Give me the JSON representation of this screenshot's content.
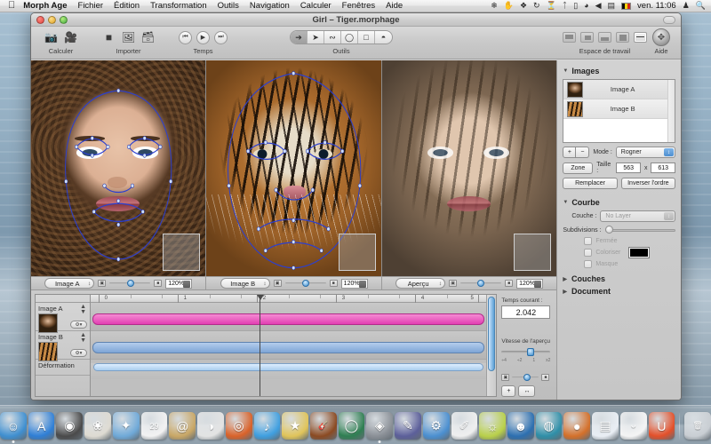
{
  "menubar": {
    "apple_icon": "apple-icon",
    "app_name": "Morph Age",
    "items": [
      "Fichier",
      "Édition",
      "Transformation",
      "Outils",
      "Navigation",
      "Calculer",
      "Fenêtres",
      "Aide"
    ],
    "status_icons": [
      "dropbox-icon",
      "hand-icon",
      "puzzle-icon",
      "sync-icon",
      "timemachine-icon",
      "bluetooth-icon",
      "display-icon",
      "wifi-icon",
      "volume-icon",
      "battery-icon"
    ],
    "flag": "belgium-flag-icon",
    "clock": "ven. 11:06",
    "user_icon": "user-icon",
    "search_icon": "search-icon"
  },
  "window": {
    "title": "Girl – Tiger.morphage",
    "toolbar": {
      "groups": [
        {
          "label": "Calculer",
          "icons": [
            "camera-icon",
            "film-icon"
          ]
        },
        {
          "label": "Importer",
          "icons": [
            "import-single-icon",
            "import-pair-icon",
            "import-stack-icon"
          ]
        },
        {
          "label": "Temps",
          "icons": [
            "rewind-icon",
            "play-icon",
            "forward-icon"
          ]
        },
        {
          "label": "Outils",
          "icons": [
            "arrow-tool-icon",
            "arrow-point-tool-icon",
            "curve-tool-icon",
            "ellipse-tool-icon",
            "rectangle-tool-icon",
            "mask-tool-icon"
          ]
        },
        {
          "label": "Espace de travail",
          "icons": [
            "layout-1-icon",
            "layout-2-icon",
            "layout-3-icon",
            "layout-4-icon",
            "layout-5-icon"
          ]
        },
        {
          "label": "Aide",
          "icons": [
            "help-icon"
          ]
        }
      ],
      "workspace_selected_index": 4,
      "tools_selected_index": 0
    }
  },
  "canvases": [
    {
      "name": "pane-image-a",
      "source_label": "Image A",
      "zoom": "120%",
      "subject": "woman-face"
    },
    {
      "name": "pane-image-b",
      "source_label": "Image B",
      "zoom": "120%",
      "subject": "tiger-face"
    },
    {
      "name": "pane-preview",
      "source_label": "Aperçu",
      "zoom": "120%",
      "subject": "morph-blend"
    }
  ],
  "timeline": {
    "tracks": [
      {
        "label": "Image A",
        "clip_color": "#e23fb3"
      },
      {
        "label": "Image B",
        "clip_color": "#7ea5d6"
      },
      {
        "label": "Déformation",
        "clip_color": "#7ea5d6"
      }
    ],
    "ruler_labels": [
      "0",
      "1",
      "2",
      "3",
      "4",
      "5"
    ],
    "playhead_time": 2.042,
    "current_time_label": "Temps courant :",
    "current_time_value": "2.042",
    "preview_speed_label": "Vitesse de l'aperçu",
    "preview_speed_ticks": [
      "÷4",
      "÷2",
      "1",
      "x2"
    ],
    "add_button": "+",
    "fit_button": "↔"
  },
  "inspector": {
    "images_section": {
      "title": "Images",
      "rows": [
        {
          "label": "Image A",
          "selected": true
        },
        {
          "label": "Image B",
          "selected": false
        }
      ],
      "add_label": "+",
      "remove_label": "−",
      "mode_label": "Mode :",
      "mode_value": "Rogner",
      "zone_button": "Zone",
      "size_label": "Taille :",
      "size_width": "563",
      "size_separator": "x",
      "size_height": "613",
      "replace_button": "Remplacer",
      "invert_button": "Inverser l'ordre"
    },
    "curve_section": {
      "title": "Courbe",
      "layer_label": "Couche :",
      "layer_value": "No Layer",
      "subdivisions_label": "Subdivisions :",
      "checkboxes": [
        {
          "label": "Fermée",
          "checked": false
        },
        {
          "label": "Coloriser",
          "checked": false
        },
        {
          "label": "Masque",
          "checked": false
        }
      ],
      "color_swatch": "#000000"
    },
    "collapsed_sections": [
      "Couches",
      "Document"
    ]
  },
  "dock": {
    "items": [
      {
        "name": "finder",
        "glyph": "☺",
        "color": "#3f8fd0",
        "running": true
      },
      {
        "name": "app-store",
        "glyph": "A",
        "color": "#2f7fd6",
        "running": false
      },
      {
        "name": "dvd-player",
        "glyph": "◉",
        "color": "#4a4a4a",
        "running": false
      },
      {
        "name": "iphoto",
        "glyph": "❀",
        "color": "#dedbd2",
        "running": false
      },
      {
        "name": "safari",
        "glyph": "✦",
        "color": "#6fa9d8",
        "running": false
      },
      {
        "name": "calendar",
        "glyph": "29",
        "color": "#f2f2f2",
        "running": false
      },
      {
        "name": "address-book",
        "glyph": "@",
        "color": "#c9a766",
        "running": false
      },
      {
        "name": "iweb",
        "glyph": "◑",
        "color": "#e3e3e3",
        "running": false
      },
      {
        "name": "photo-booth",
        "glyph": "◎",
        "color": "#d9622a",
        "running": false
      },
      {
        "name": "itunes",
        "glyph": "♪",
        "color": "#3f9fe0",
        "running": false
      },
      {
        "name": "imovie",
        "glyph": "★",
        "color": "#e0c45a",
        "running": false
      },
      {
        "name": "garageband",
        "glyph": "🎸",
        "color": "#8b4a22",
        "running": false
      },
      {
        "name": "quicktime",
        "glyph": "◯",
        "color": "#2f7f52",
        "running": false
      },
      {
        "name": "morph-age",
        "glyph": "◈",
        "color": "#8a8f96",
        "running": true
      },
      {
        "name": "preview",
        "glyph": "✎",
        "color": "#5c5f9a",
        "running": false
      },
      {
        "name": "system-preferences",
        "glyph": "⚙",
        "color": "#4b8fd0",
        "running": false
      },
      {
        "name": "textedit",
        "glyph": "✐",
        "color": "#efefef",
        "running": false
      },
      {
        "name": "utilities",
        "glyph": "☼",
        "color": "#b9d04a",
        "running": false
      },
      {
        "name": "faces",
        "glyph": "☻",
        "color": "#2c6fb0",
        "running": false
      },
      {
        "name": "globe",
        "glyph": "◍",
        "color": "#2f8fa8",
        "running": false
      },
      {
        "name": "basketball",
        "glyph": "●",
        "color": "#d4702a",
        "running": false
      },
      {
        "name": "documents-stack",
        "glyph": "▤",
        "color": "#e9eef4",
        "running": false
      },
      {
        "name": "cow-app",
        "glyph": "ᵕ",
        "color": "#f4f4f4",
        "running": false
      },
      {
        "name": "magnet-app",
        "glyph": "U",
        "color": "#e3502a",
        "running": false
      },
      {
        "name": "trash",
        "glyph": "🗑",
        "color": "#c9ced3",
        "running": false
      }
    ]
  }
}
